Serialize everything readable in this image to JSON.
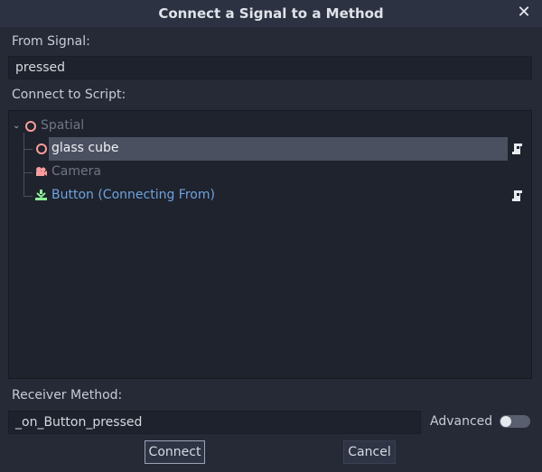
{
  "window": {
    "title": "Connect a Signal to a Method"
  },
  "from_signal": {
    "label": "From Signal:",
    "value": "pressed"
  },
  "connect_script": {
    "label": "Connect to Script:"
  },
  "tree": {
    "nodes": [
      {
        "label": "Spatial"
      },
      {
        "label": "glass cube"
      },
      {
        "label": "Camera"
      },
      {
        "label": "Button (Connecting From)"
      }
    ]
  },
  "receiver": {
    "label": "Receiver Method:",
    "value": "_on_Button_pressed",
    "advanced_label": "Advanced"
  },
  "buttons": {
    "connect": "Connect",
    "cancel": "Cancel"
  },
  "colors": {
    "accent_blue": "#6ea2e0",
    "node_red": "#fc9c9c",
    "button_green": "#8eef97"
  }
}
